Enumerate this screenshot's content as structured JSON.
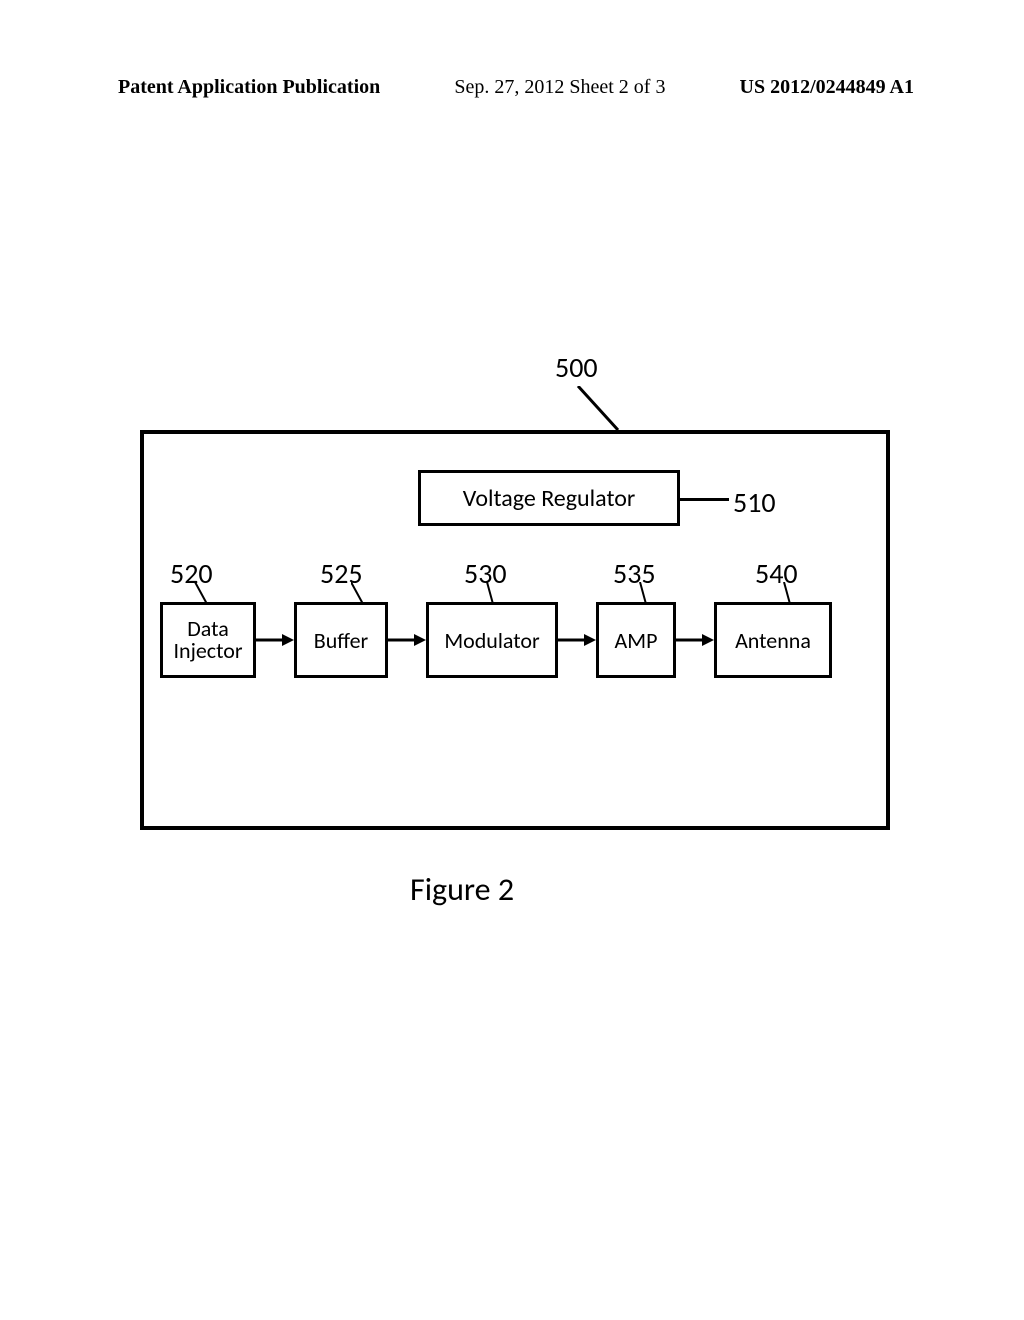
{
  "header": {
    "left": "Patent Application Publication",
    "middle": "Sep. 27, 2012  Sheet 2 of 3",
    "right": "US 2012/0244849 A1"
  },
  "diagram": {
    "container_ref": "500",
    "voltage_regulator": {
      "label": "Voltage Regulator",
      "ref": "510"
    },
    "chain": [
      {
        "id": "data_injector",
        "ref": "520",
        "label_line1": "Data",
        "label_line2": "Injector"
      },
      {
        "id": "buffer",
        "ref": "525",
        "label": "Buffer"
      },
      {
        "id": "modulator",
        "ref": "530",
        "label": "Modulator"
      },
      {
        "id": "amp",
        "ref": "535",
        "label": "AMP"
      },
      {
        "id": "antenna",
        "ref": "540",
        "label": "Antenna"
      }
    ]
  },
  "caption": "Figure 2"
}
